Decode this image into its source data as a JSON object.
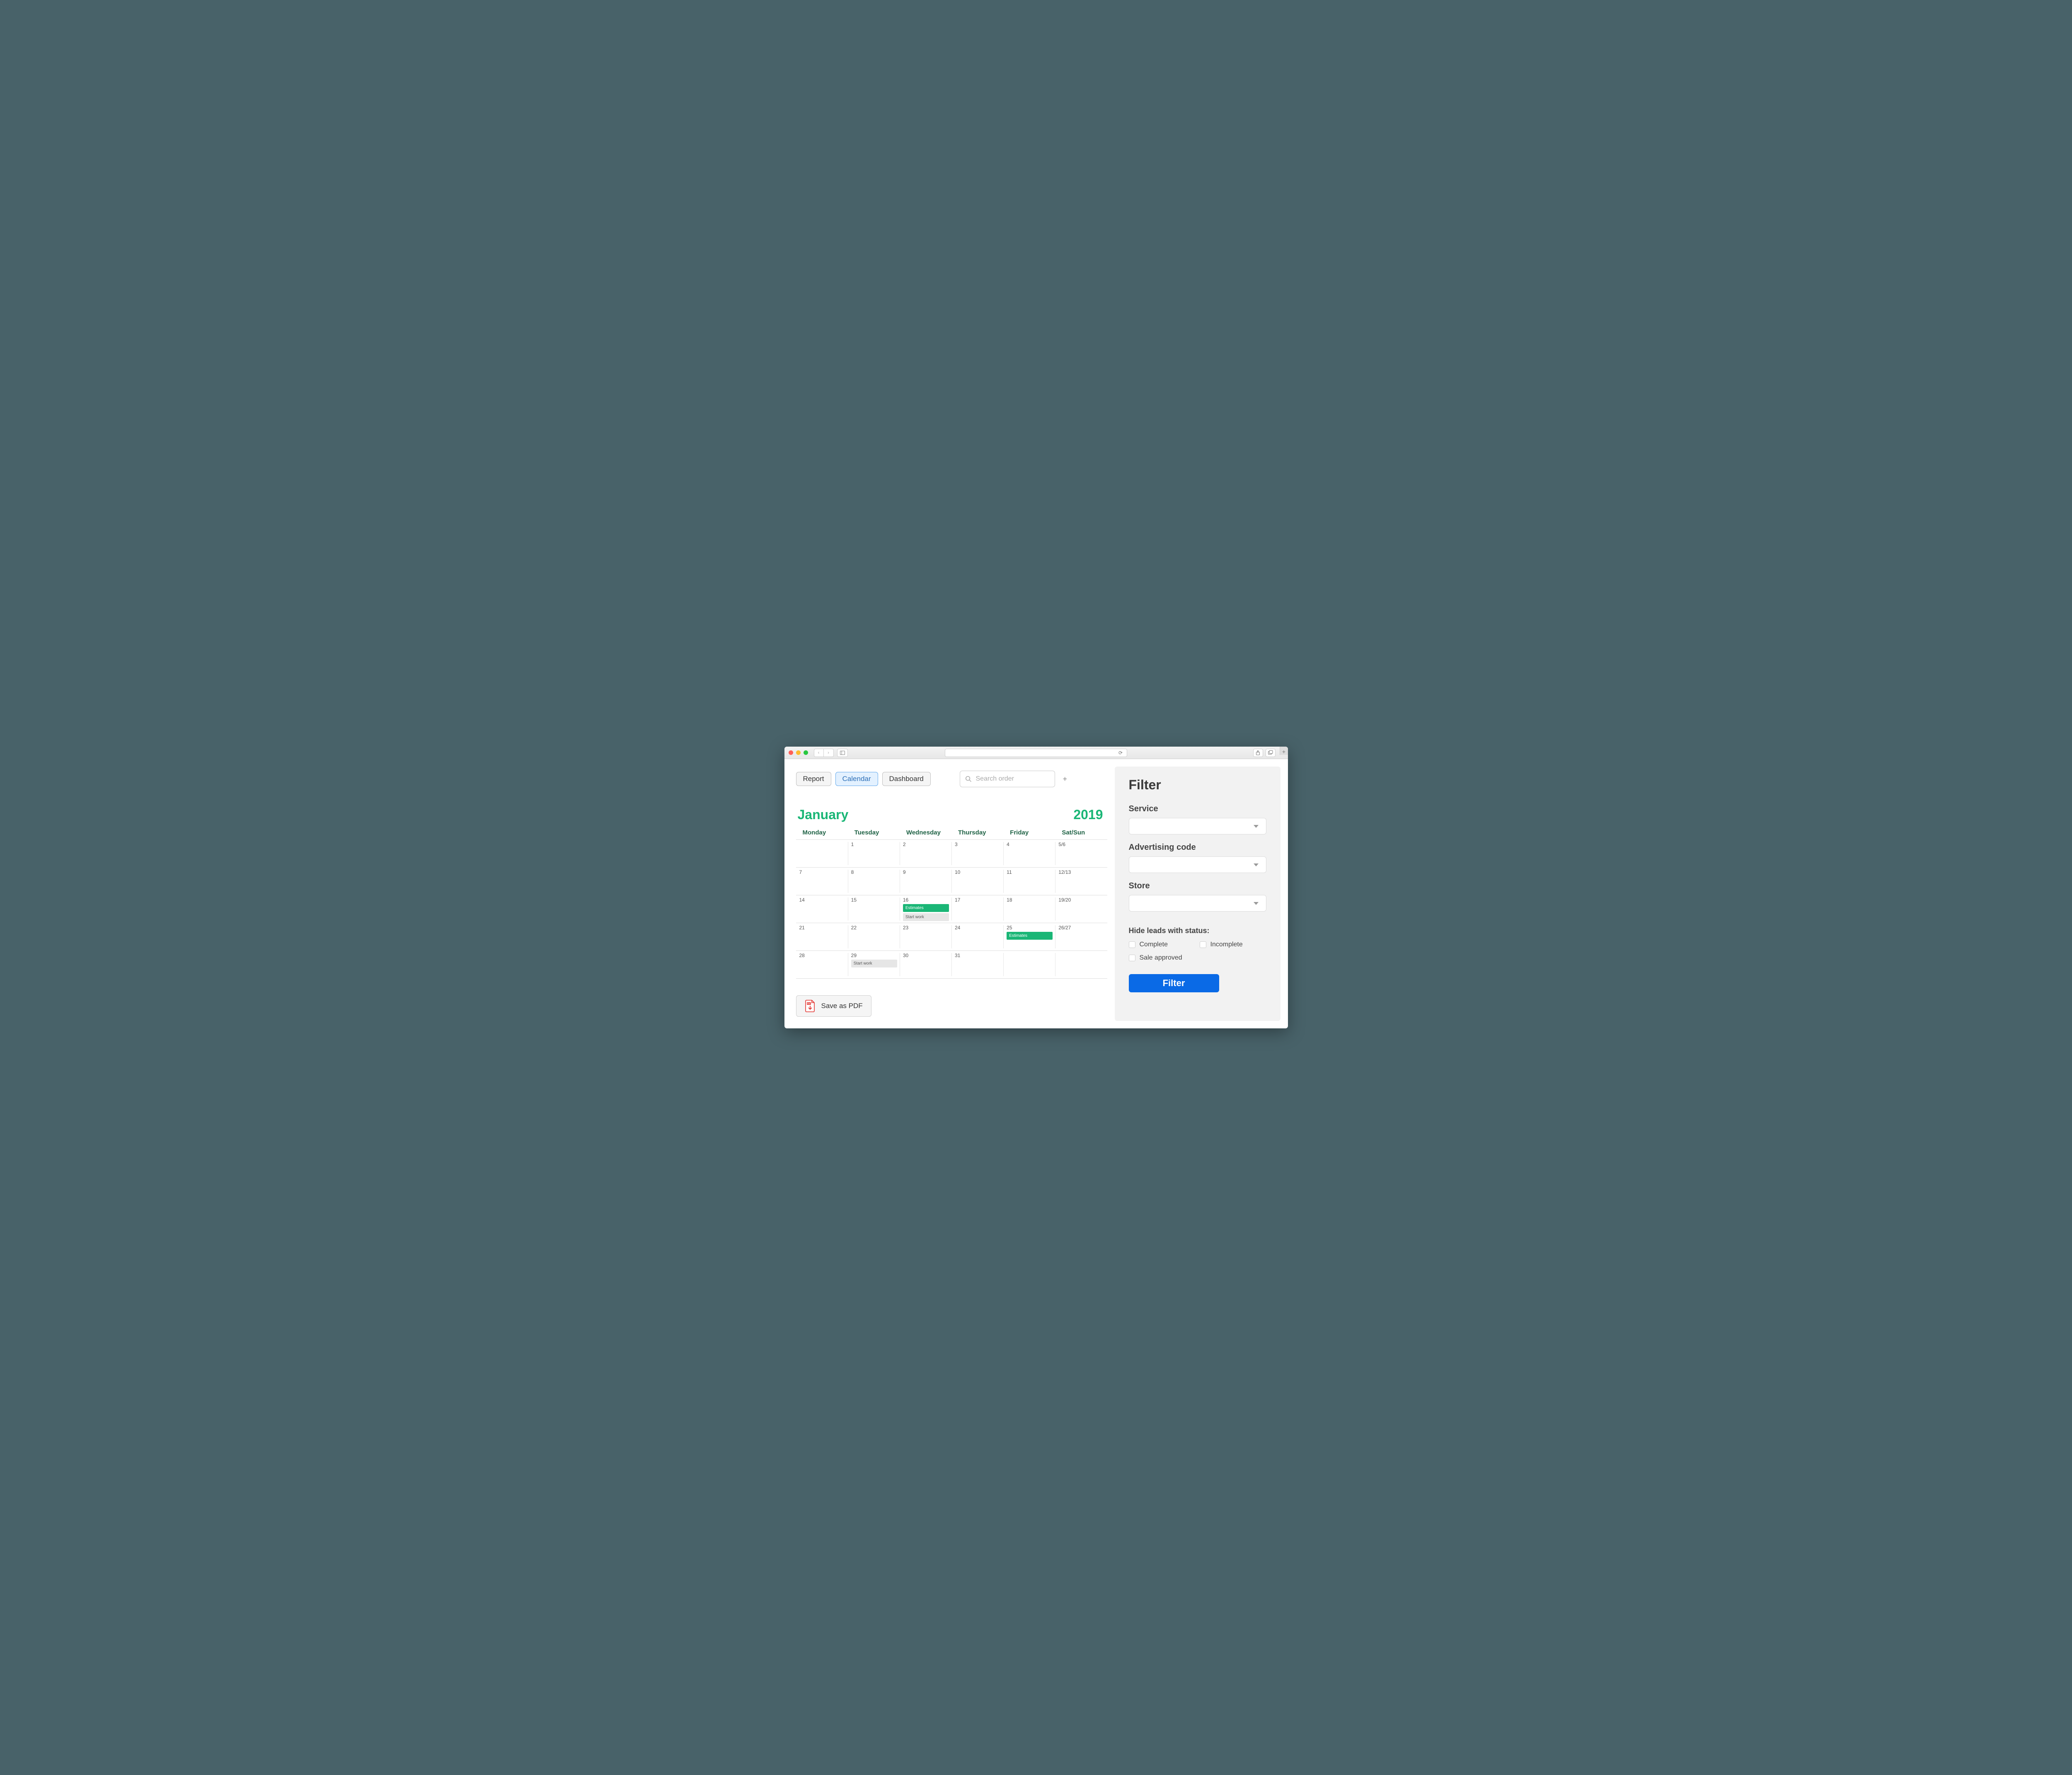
{
  "tabs": [
    "Report",
    "Calendar",
    "Dashboard"
  ],
  "search": {
    "placeholder": "Search order"
  },
  "calendar": {
    "month": "January",
    "year": "2019",
    "dayHeaders": [
      "Monday",
      "Tuesday",
      "Wednesday",
      "Thursday",
      "Friday",
      "Sat/Sun"
    ],
    "weeks": [
      [
        {
          "d": "1"
        },
        {
          "d": "2"
        },
        {
          "d": "3"
        },
        {
          "d": "4"
        },
        {
          "d": "5/6"
        }
      ],
      [
        {
          "d": "7"
        },
        {
          "d": "8"
        },
        {
          "d": "9"
        },
        {
          "d": "10"
        },
        {
          "d": "11"
        },
        {
          "d": "12/13"
        }
      ],
      [
        {
          "d": "14"
        },
        {
          "d": "15"
        },
        {
          "d": "16",
          "events": [
            {
              "label": "Estimates",
              "kind": "green"
            },
            {
              "label": "Start work",
              "kind": "grey"
            }
          ]
        },
        {
          "d": "17"
        },
        {
          "d": "18"
        },
        {
          "d": "19/20"
        }
      ],
      [
        {
          "d": "21"
        },
        {
          "d": "22"
        },
        {
          "d": "23"
        },
        {
          "d": "24"
        },
        {
          "d": "25",
          "events": [
            {
              "label": "Estimates",
              "kind": "green"
            }
          ]
        },
        {
          "d": "26/27"
        }
      ],
      [
        {
          "d": "28"
        },
        {
          "d": "29",
          "events": [
            {
              "label": "Start work",
              "kind": "grey"
            }
          ]
        },
        {
          "d": "30"
        },
        {
          "d": "31"
        },
        {
          "d": ""
        },
        {
          "d": ""
        }
      ]
    ]
  },
  "pdfButton": "Save as PDF",
  "filter": {
    "title": "Filter",
    "fields": [
      "Service",
      "Advertising code",
      "Store"
    ],
    "hideTitle": "Hide leads with status:",
    "checks": [
      "Complete",
      "Incomplete",
      "Sale approved"
    ],
    "button": "Filter"
  }
}
